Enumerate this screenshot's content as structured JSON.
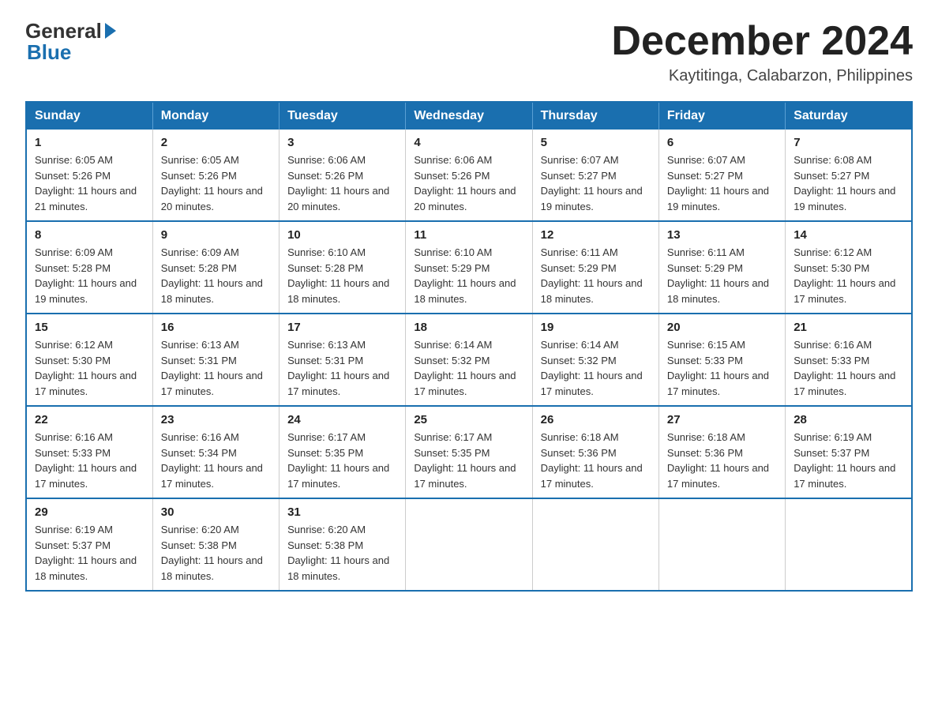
{
  "header": {
    "logo_general": "General",
    "logo_blue": "Blue",
    "month_title": "December 2024",
    "subtitle": "Kaytitinga, Calabarzon, Philippines"
  },
  "days_of_week": [
    "Sunday",
    "Monday",
    "Tuesday",
    "Wednesday",
    "Thursday",
    "Friday",
    "Saturday"
  ],
  "weeks": [
    [
      {
        "day": "1",
        "sunrise": "6:05 AM",
        "sunset": "5:26 PM",
        "daylight": "11 hours and 21 minutes."
      },
      {
        "day": "2",
        "sunrise": "6:05 AM",
        "sunset": "5:26 PM",
        "daylight": "11 hours and 20 minutes."
      },
      {
        "day": "3",
        "sunrise": "6:06 AM",
        "sunset": "5:26 PM",
        "daylight": "11 hours and 20 minutes."
      },
      {
        "day": "4",
        "sunrise": "6:06 AM",
        "sunset": "5:26 PM",
        "daylight": "11 hours and 20 minutes."
      },
      {
        "day": "5",
        "sunrise": "6:07 AM",
        "sunset": "5:27 PM",
        "daylight": "11 hours and 19 minutes."
      },
      {
        "day": "6",
        "sunrise": "6:07 AM",
        "sunset": "5:27 PM",
        "daylight": "11 hours and 19 minutes."
      },
      {
        "day": "7",
        "sunrise": "6:08 AM",
        "sunset": "5:27 PM",
        "daylight": "11 hours and 19 minutes."
      }
    ],
    [
      {
        "day": "8",
        "sunrise": "6:09 AM",
        "sunset": "5:28 PM",
        "daylight": "11 hours and 19 minutes."
      },
      {
        "day": "9",
        "sunrise": "6:09 AM",
        "sunset": "5:28 PM",
        "daylight": "11 hours and 18 minutes."
      },
      {
        "day": "10",
        "sunrise": "6:10 AM",
        "sunset": "5:28 PM",
        "daylight": "11 hours and 18 minutes."
      },
      {
        "day": "11",
        "sunrise": "6:10 AM",
        "sunset": "5:29 PM",
        "daylight": "11 hours and 18 minutes."
      },
      {
        "day": "12",
        "sunrise": "6:11 AM",
        "sunset": "5:29 PM",
        "daylight": "11 hours and 18 minutes."
      },
      {
        "day": "13",
        "sunrise": "6:11 AM",
        "sunset": "5:29 PM",
        "daylight": "11 hours and 18 minutes."
      },
      {
        "day": "14",
        "sunrise": "6:12 AM",
        "sunset": "5:30 PM",
        "daylight": "11 hours and 17 minutes."
      }
    ],
    [
      {
        "day": "15",
        "sunrise": "6:12 AM",
        "sunset": "5:30 PM",
        "daylight": "11 hours and 17 minutes."
      },
      {
        "day": "16",
        "sunrise": "6:13 AM",
        "sunset": "5:31 PM",
        "daylight": "11 hours and 17 minutes."
      },
      {
        "day": "17",
        "sunrise": "6:13 AM",
        "sunset": "5:31 PM",
        "daylight": "11 hours and 17 minutes."
      },
      {
        "day": "18",
        "sunrise": "6:14 AM",
        "sunset": "5:32 PM",
        "daylight": "11 hours and 17 minutes."
      },
      {
        "day": "19",
        "sunrise": "6:14 AM",
        "sunset": "5:32 PM",
        "daylight": "11 hours and 17 minutes."
      },
      {
        "day": "20",
        "sunrise": "6:15 AM",
        "sunset": "5:33 PM",
        "daylight": "11 hours and 17 minutes."
      },
      {
        "day": "21",
        "sunrise": "6:16 AM",
        "sunset": "5:33 PM",
        "daylight": "11 hours and 17 minutes."
      }
    ],
    [
      {
        "day": "22",
        "sunrise": "6:16 AM",
        "sunset": "5:33 PM",
        "daylight": "11 hours and 17 minutes."
      },
      {
        "day": "23",
        "sunrise": "6:16 AM",
        "sunset": "5:34 PM",
        "daylight": "11 hours and 17 minutes."
      },
      {
        "day": "24",
        "sunrise": "6:17 AM",
        "sunset": "5:35 PM",
        "daylight": "11 hours and 17 minutes."
      },
      {
        "day": "25",
        "sunrise": "6:17 AM",
        "sunset": "5:35 PM",
        "daylight": "11 hours and 17 minutes."
      },
      {
        "day": "26",
        "sunrise": "6:18 AM",
        "sunset": "5:36 PM",
        "daylight": "11 hours and 17 minutes."
      },
      {
        "day": "27",
        "sunrise": "6:18 AM",
        "sunset": "5:36 PM",
        "daylight": "11 hours and 17 minutes."
      },
      {
        "day": "28",
        "sunrise": "6:19 AM",
        "sunset": "5:37 PM",
        "daylight": "11 hours and 17 minutes."
      }
    ],
    [
      {
        "day": "29",
        "sunrise": "6:19 AM",
        "sunset": "5:37 PM",
        "daylight": "11 hours and 18 minutes."
      },
      {
        "day": "30",
        "sunrise": "6:20 AM",
        "sunset": "5:38 PM",
        "daylight": "11 hours and 18 minutes."
      },
      {
        "day": "31",
        "sunrise": "6:20 AM",
        "sunset": "5:38 PM",
        "daylight": "11 hours and 18 minutes."
      },
      null,
      null,
      null,
      null
    ]
  ],
  "labels": {
    "sunrise_prefix": "Sunrise: ",
    "sunset_prefix": "Sunset: ",
    "daylight_prefix": "Daylight: "
  }
}
